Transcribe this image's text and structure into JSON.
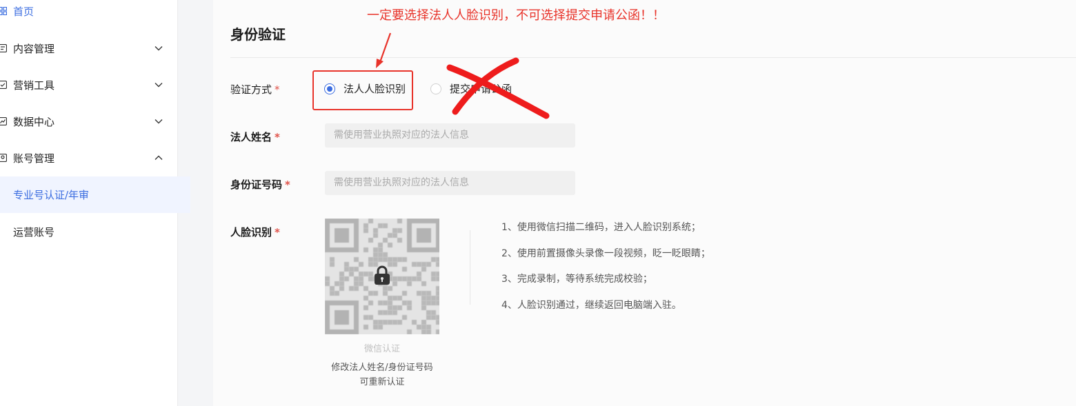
{
  "sidebar": {
    "items": [
      {
        "label": "首页",
        "icon": "home-icon"
      },
      {
        "label": "内容管理",
        "icon": "content-icon",
        "chevron": "chevron-down-icon"
      },
      {
        "label": "营销工具",
        "icon": "marketing-icon",
        "chevron": "chevron-down-icon"
      },
      {
        "label": "数据中心",
        "icon": "data-icon",
        "chevron": "chevron-down-icon"
      },
      {
        "label": "账号管理",
        "icon": "account-icon",
        "chevron": "chevron-up-icon"
      }
    ],
    "sub_items": [
      {
        "label": "专业号认证/年审",
        "active": true
      },
      {
        "label": "运营账号",
        "active": false
      }
    ]
  },
  "page": {
    "title": "身份验证",
    "required_mark": "*"
  },
  "form": {
    "method_label": "验证方式",
    "method_options": [
      "法人人脸识别",
      "提交申请公函"
    ],
    "method_selected": "法人人脸识别",
    "name_label": "法人姓名",
    "name_placeholder": "需使用营业执照对应的法人信息",
    "id_label": "身份证号码",
    "id_placeholder": "需使用营业执照对应的法人信息",
    "face_label": "人脸识别"
  },
  "qr": {
    "caption": "微信认证",
    "note_line1": "修改法人姓名/身份证号码",
    "note_line2": "可重新认证"
  },
  "steps": [
    "1、使用微信扫描二维码，进入人脸识别系统；",
    "2、使用前置摄像头录像一段视频，眨一眨眼睛；",
    "3、完成录制，等待系统完成校验；",
    "4、人脸识别通过，继续返回电脑端入驻。"
  ],
  "annotation": {
    "text": "一定要选择法人人脸识别，不可选择提交申请公函！！",
    "color": "#e8332a"
  },
  "colors": {
    "accent": "#3b6de0",
    "required": "#e0534a"
  }
}
